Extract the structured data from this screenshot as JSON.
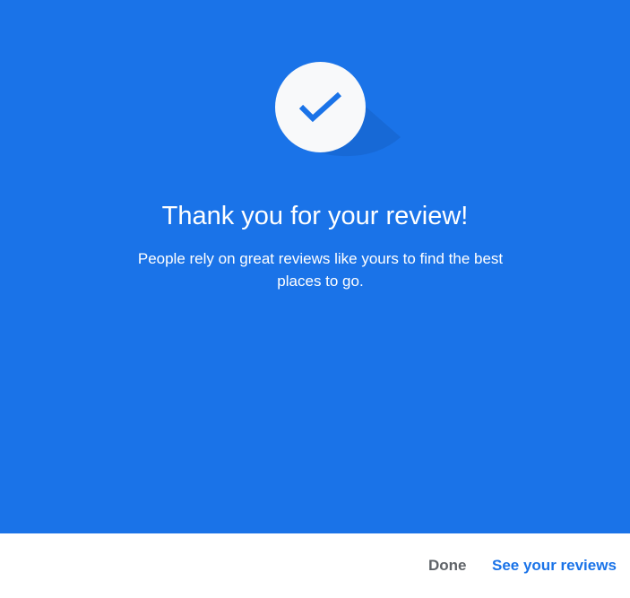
{
  "colors": {
    "hero_background": "#1a73e8",
    "badge_background": "#f8f9fa",
    "check": "#1a73e8",
    "done_text": "#5f6368",
    "primary_action_text": "#1a73e8"
  },
  "hero": {
    "icon": "check-icon",
    "title": "Thank you for your review!",
    "subtitle": "People rely on great reviews like yours to find the best places to go."
  },
  "footer": {
    "done_label": "Done",
    "see_reviews_label": "See your reviews"
  }
}
